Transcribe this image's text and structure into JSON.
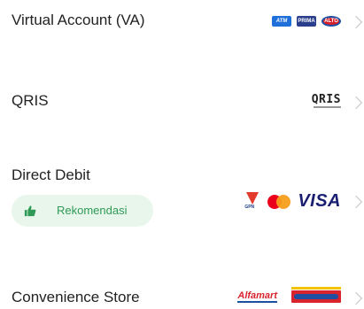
{
  "methods": [
    {
      "label": "Virtual Account (VA)",
      "logos": [
        "atm",
        "prima",
        "alto"
      ],
      "logo_text": {
        "atm": "ATM",
        "prima": "PRIMA",
        "alto": "ALTO"
      }
    },
    {
      "label": "QRIS",
      "logos": [
        "qris"
      ],
      "logo_text": {
        "qris": "QRIS"
      }
    },
    {
      "label": "Direct Debit",
      "badge": "Rekomendasi",
      "logos": [
        "gpn",
        "mastercard",
        "visa"
      ],
      "logo_text": {
        "gpn": "GPN",
        "visa": "VISA"
      }
    },
    {
      "label": "Convenience Store",
      "logos": [
        "alfamart",
        "indomaret"
      ],
      "logo_text": {
        "alfamart": "Alfamart"
      }
    }
  ],
  "colors": {
    "badge_bg": "#e8f6ec",
    "badge_text": "#2e9a55",
    "chevron": "#c4c4c4"
  }
}
